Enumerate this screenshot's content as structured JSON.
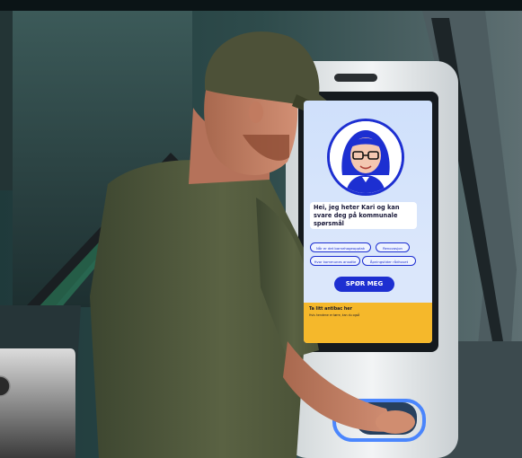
{
  "kiosk": {
    "greeting": "Hei, jeg heter Kari og kan svare deg på kommunale spørsmål",
    "chips": [
      "Når er det barnehageopptak",
      "Renovasjon",
      "Hvor kommunes ansatte",
      "Åpningstider rådhuset"
    ],
    "ask_button": "SPØR MEG",
    "feedback_title": "Ta litt antibac her",
    "feedback_body": "Hvis hendene er tørre, kan du også"
  }
}
